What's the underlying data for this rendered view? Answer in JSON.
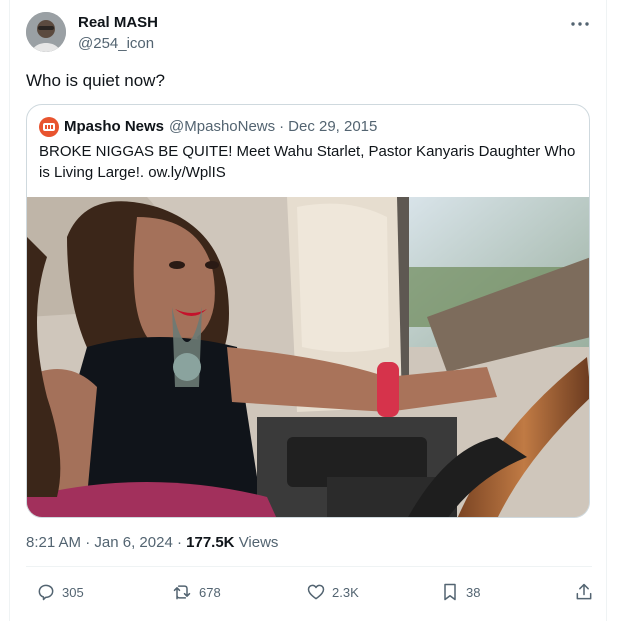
{
  "author": {
    "display_name": "Real MASH",
    "handle": "@254_icon",
    "avatar_icon": "user-avatar-photo"
  },
  "tweet": {
    "text": "Who is quiet now?"
  },
  "quoted_tweet": {
    "display_name": "Mpasho News",
    "handle": "@MpashoNews",
    "separator": "·",
    "date": "Dec 29, 2015",
    "text": "BROKE NIGGAS BE QUITE! Meet Wahu Starlet, Pastor Kanyaris Daughter Who is Living Large!. ow.ly/WplIS",
    "logo_icon": "mpasho-logo-icon",
    "media_icon": "photo-woman-in-car"
  },
  "meta": {
    "time": "8:21 AM",
    "separator": "·",
    "date": "Jan 6, 2024",
    "separator2": "·",
    "views_count": "177.5K",
    "views_label": "Views"
  },
  "actions": {
    "replies": "305",
    "reposts": "678",
    "likes": "2.3K",
    "bookmarks": "38"
  },
  "colors": {
    "text_primary": "#0f1419",
    "text_secondary": "#536471",
    "border": "#cfd9de",
    "mpasho_brand": "#e8542f"
  }
}
